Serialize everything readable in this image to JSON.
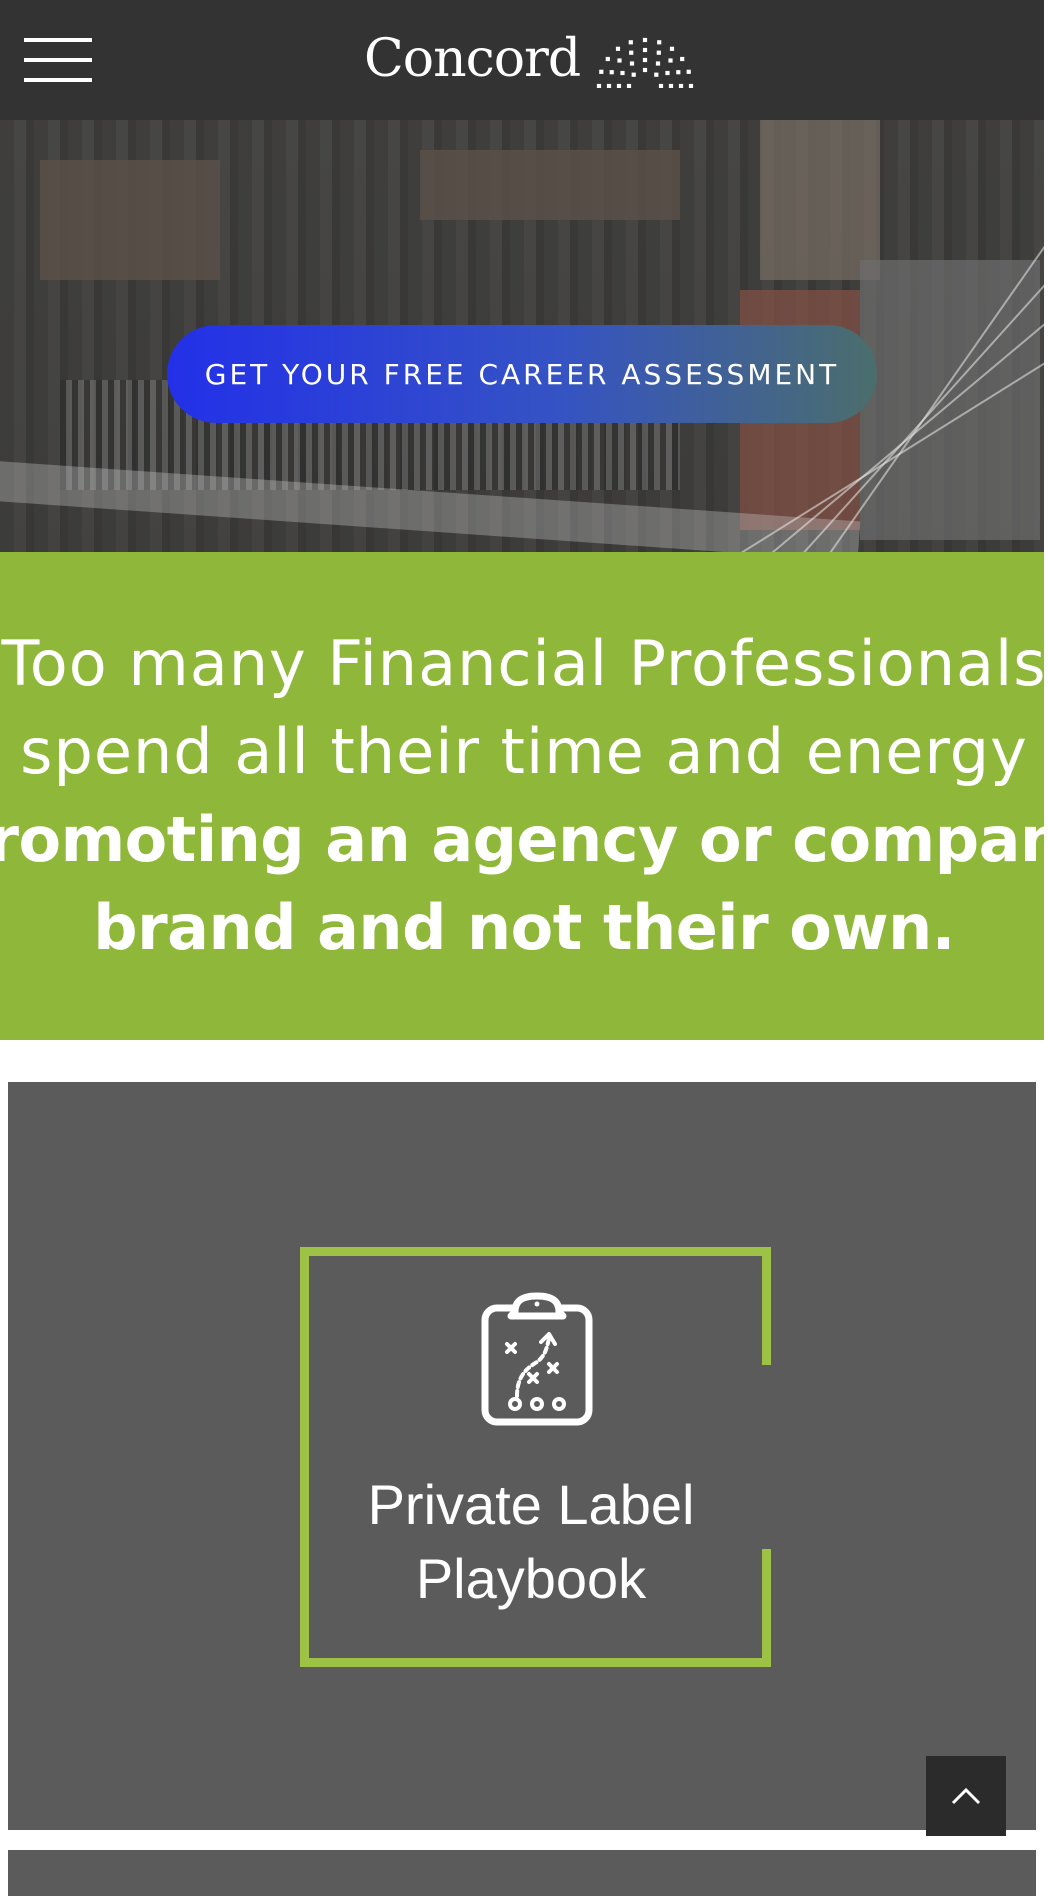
{
  "header": {
    "menu_icon": "hamburger-menu-icon",
    "logo_text": "Concord",
    "logo_mark_icon": "concord-arc-dots-icon"
  },
  "hero": {
    "cta_label": "GET YOUR FREE CAREER ASSESSMENT",
    "cta_gradient": [
      "#2330e8",
      "#3553c4",
      "#4b6e6c"
    ]
  },
  "banner": {
    "line1": "Too many Financial Professionals",
    "line2": "spend all their time and energy",
    "line3": "promoting an agency or company",
    "line4": "brand and not their own.",
    "background": "#8fb83a"
  },
  "card": {
    "icon": "clipboard-playbook-icon",
    "title_line1": "Private Label",
    "title_line2": "Playbook",
    "accent": "#9dc246",
    "background": "#5b5b5b"
  },
  "back_to_top": {
    "icon": "chevron-up-icon"
  },
  "colors": {
    "header_bg": "#333333",
    "white": "#ffffff"
  }
}
